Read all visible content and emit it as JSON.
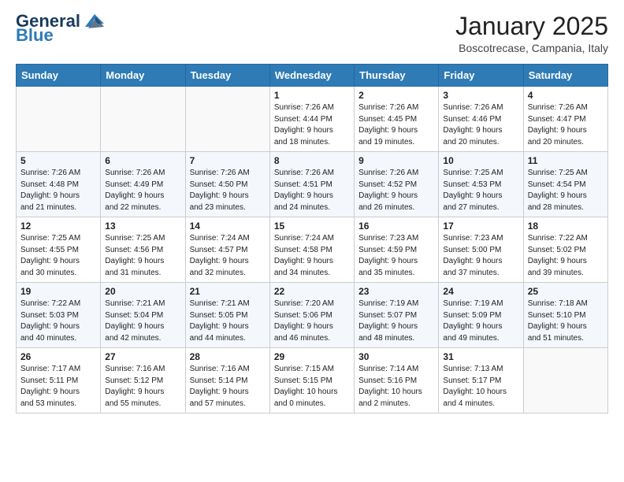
{
  "header": {
    "logo_general": "General",
    "logo_blue": "Blue",
    "month": "January 2025",
    "location": "Boscotrecase, Campania, Italy"
  },
  "weekdays": [
    "Sunday",
    "Monday",
    "Tuesday",
    "Wednesday",
    "Thursday",
    "Friday",
    "Saturday"
  ],
  "weeks": [
    [
      {
        "day": "",
        "info": ""
      },
      {
        "day": "",
        "info": ""
      },
      {
        "day": "",
        "info": ""
      },
      {
        "day": "1",
        "info": "Sunrise: 7:26 AM\nSunset: 4:44 PM\nDaylight: 9 hours\nand 18 minutes."
      },
      {
        "day": "2",
        "info": "Sunrise: 7:26 AM\nSunset: 4:45 PM\nDaylight: 9 hours\nand 19 minutes."
      },
      {
        "day": "3",
        "info": "Sunrise: 7:26 AM\nSunset: 4:46 PM\nDaylight: 9 hours\nand 20 minutes."
      },
      {
        "day": "4",
        "info": "Sunrise: 7:26 AM\nSunset: 4:47 PM\nDaylight: 9 hours\nand 20 minutes."
      }
    ],
    [
      {
        "day": "5",
        "info": "Sunrise: 7:26 AM\nSunset: 4:48 PM\nDaylight: 9 hours\nand 21 minutes."
      },
      {
        "day": "6",
        "info": "Sunrise: 7:26 AM\nSunset: 4:49 PM\nDaylight: 9 hours\nand 22 minutes."
      },
      {
        "day": "7",
        "info": "Sunrise: 7:26 AM\nSunset: 4:50 PM\nDaylight: 9 hours\nand 23 minutes."
      },
      {
        "day": "8",
        "info": "Sunrise: 7:26 AM\nSunset: 4:51 PM\nDaylight: 9 hours\nand 24 minutes."
      },
      {
        "day": "9",
        "info": "Sunrise: 7:26 AM\nSunset: 4:52 PM\nDaylight: 9 hours\nand 26 minutes."
      },
      {
        "day": "10",
        "info": "Sunrise: 7:25 AM\nSunset: 4:53 PM\nDaylight: 9 hours\nand 27 minutes."
      },
      {
        "day": "11",
        "info": "Sunrise: 7:25 AM\nSunset: 4:54 PM\nDaylight: 9 hours\nand 28 minutes."
      }
    ],
    [
      {
        "day": "12",
        "info": "Sunrise: 7:25 AM\nSunset: 4:55 PM\nDaylight: 9 hours\nand 30 minutes."
      },
      {
        "day": "13",
        "info": "Sunrise: 7:25 AM\nSunset: 4:56 PM\nDaylight: 9 hours\nand 31 minutes."
      },
      {
        "day": "14",
        "info": "Sunrise: 7:24 AM\nSunset: 4:57 PM\nDaylight: 9 hours\nand 32 minutes."
      },
      {
        "day": "15",
        "info": "Sunrise: 7:24 AM\nSunset: 4:58 PM\nDaylight: 9 hours\nand 34 minutes."
      },
      {
        "day": "16",
        "info": "Sunrise: 7:23 AM\nSunset: 4:59 PM\nDaylight: 9 hours\nand 35 minutes."
      },
      {
        "day": "17",
        "info": "Sunrise: 7:23 AM\nSunset: 5:00 PM\nDaylight: 9 hours\nand 37 minutes."
      },
      {
        "day": "18",
        "info": "Sunrise: 7:22 AM\nSunset: 5:02 PM\nDaylight: 9 hours\nand 39 minutes."
      }
    ],
    [
      {
        "day": "19",
        "info": "Sunrise: 7:22 AM\nSunset: 5:03 PM\nDaylight: 9 hours\nand 40 minutes."
      },
      {
        "day": "20",
        "info": "Sunrise: 7:21 AM\nSunset: 5:04 PM\nDaylight: 9 hours\nand 42 minutes."
      },
      {
        "day": "21",
        "info": "Sunrise: 7:21 AM\nSunset: 5:05 PM\nDaylight: 9 hours\nand 44 minutes."
      },
      {
        "day": "22",
        "info": "Sunrise: 7:20 AM\nSunset: 5:06 PM\nDaylight: 9 hours\nand 46 minutes."
      },
      {
        "day": "23",
        "info": "Sunrise: 7:19 AM\nSunset: 5:07 PM\nDaylight: 9 hours\nand 48 minutes."
      },
      {
        "day": "24",
        "info": "Sunrise: 7:19 AM\nSunset: 5:09 PM\nDaylight: 9 hours\nand 49 minutes."
      },
      {
        "day": "25",
        "info": "Sunrise: 7:18 AM\nSunset: 5:10 PM\nDaylight: 9 hours\nand 51 minutes."
      }
    ],
    [
      {
        "day": "26",
        "info": "Sunrise: 7:17 AM\nSunset: 5:11 PM\nDaylight: 9 hours\nand 53 minutes."
      },
      {
        "day": "27",
        "info": "Sunrise: 7:16 AM\nSunset: 5:12 PM\nDaylight: 9 hours\nand 55 minutes."
      },
      {
        "day": "28",
        "info": "Sunrise: 7:16 AM\nSunset: 5:14 PM\nDaylight: 9 hours\nand 57 minutes."
      },
      {
        "day": "29",
        "info": "Sunrise: 7:15 AM\nSunset: 5:15 PM\nDaylight: 10 hours\nand 0 minutes."
      },
      {
        "day": "30",
        "info": "Sunrise: 7:14 AM\nSunset: 5:16 PM\nDaylight: 10 hours\nand 2 minutes."
      },
      {
        "day": "31",
        "info": "Sunrise: 7:13 AM\nSunset: 5:17 PM\nDaylight: 10 hours\nand 4 minutes."
      },
      {
        "day": "",
        "info": ""
      }
    ]
  ]
}
